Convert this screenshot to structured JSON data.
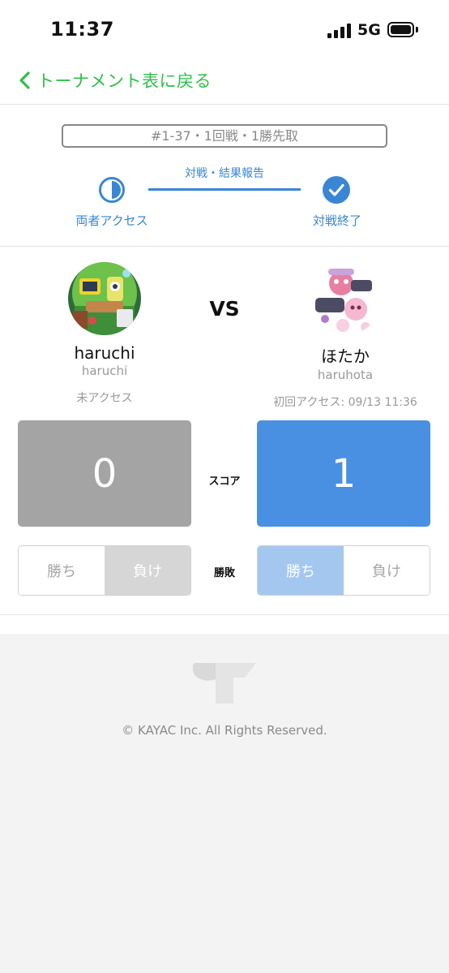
{
  "status": {
    "time": "11:37",
    "network": "5G"
  },
  "nav": {
    "back_label": "トーナメント表に戻る"
  },
  "match": {
    "id_label": "#1-37・1回戦・1勝先取"
  },
  "progress": {
    "center_label": "対戦・結果報告",
    "left_label": "両者アクセス",
    "right_label": "対戦終了",
    "fill_fraction": 1.0
  },
  "vs_label": "VS",
  "players": [
    {
      "name": "haruchi",
      "id": "haruchi",
      "access": "未アクセス",
      "score": "0"
    },
    {
      "name": "ほたか",
      "id": "haruhota",
      "access": "初回アクセス: 09/13 11:36",
      "score": "1"
    }
  ],
  "labels": {
    "score": "スコア",
    "result": "勝敗",
    "win": "勝ち",
    "lose": "負け"
  },
  "footer": {
    "copyright": "© KAYAC Inc. All Rights Reserved."
  },
  "colors": {
    "accent_green": "#2fbf4a",
    "accent_blue": "#3a86d4",
    "score_blue": "#4a90e2",
    "score_gray": "#a4a4a4"
  }
}
